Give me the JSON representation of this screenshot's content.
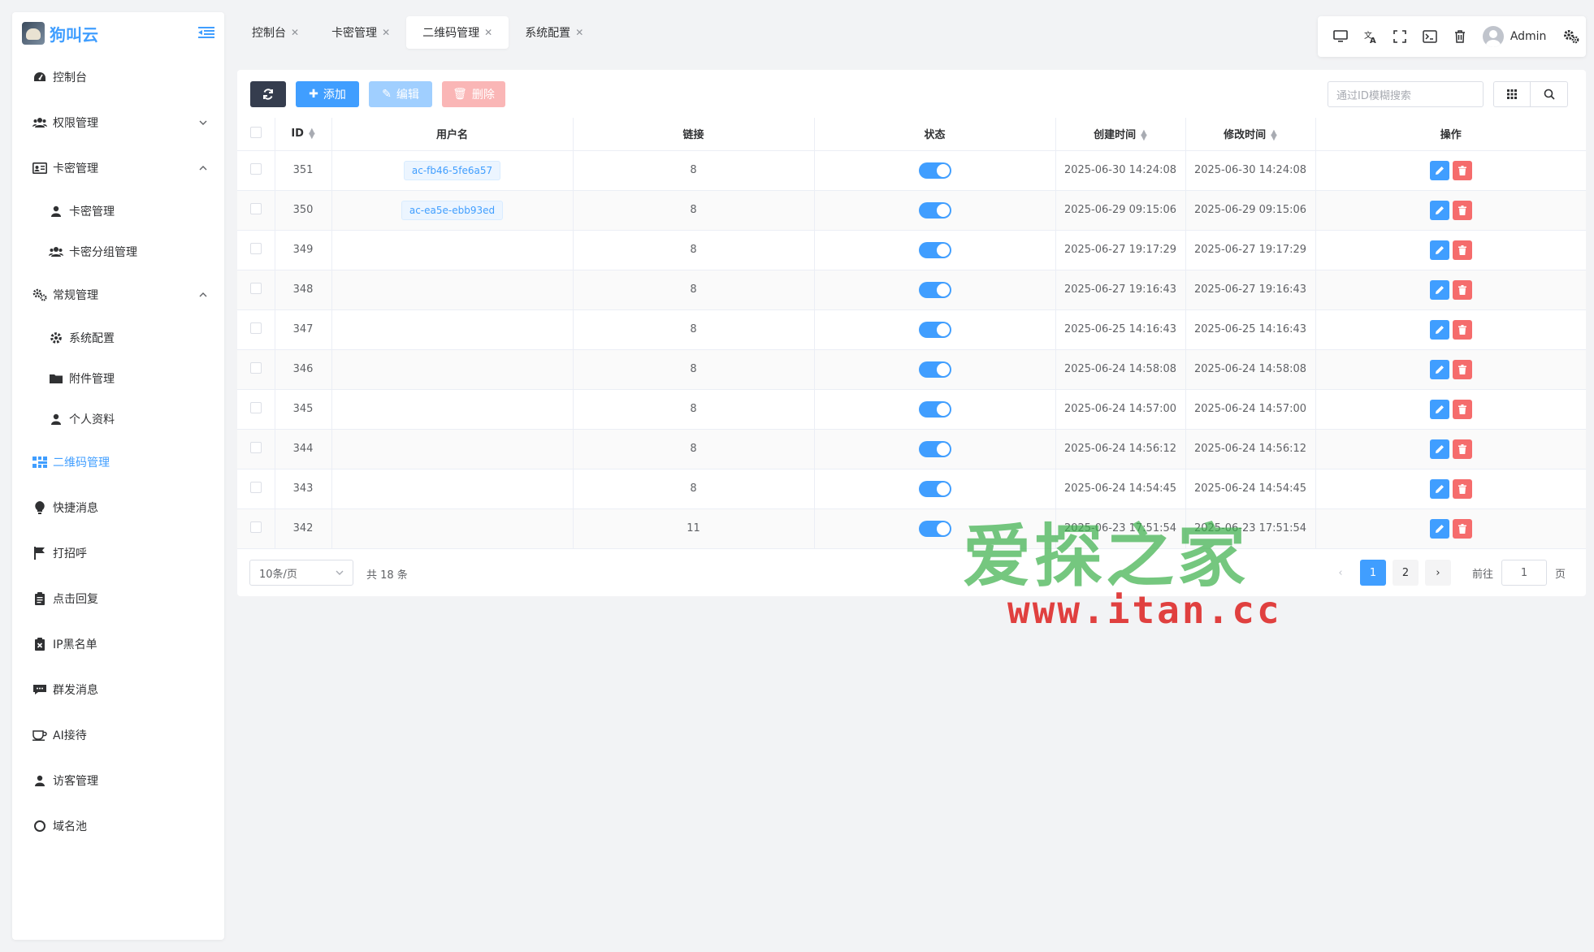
{
  "app": {
    "logo_text": "狗叫云"
  },
  "sidebar": {
    "items": [
      {
        "label": "控制台",
        "icon": "dashboard-icon",
        "type": "top"
      },
      {
        "label": "权限管理",
        "icon": "users-icon",
        "type": "top",
        "arrow": "down"
      },
      {
        "label": "卡密管理",
        "icon": "id-card-icon",
        "type": "top",
        "arrow": "up"
      },
      {
        "label": "卡密管理",
        "icon": "user-icon",
        "type": "sub"
      },
      {
        "label": "卡密分组管理",
        "icon": "users-icon",
        "type": "sub"
      },
      {
        "label": "常规管理",
        "icon": "cogs-icon",
        "type": "top",
        "arrow": "up"
      },
      {
        "label": "系统配置",
        "icon": "gear-icon",
        "type": "sub"
      },
      {
        "label": "附件管理",
        "icon": "folder-icon",
        "type": "sub"
      },
      {
        "label": "个人资料",
        "icon": "user-icon",
        "type": "sub"
      },
      {
        "label": "二维码管理",
        "icon": "qrcode-icon",
        "type": "top",
        "active": true
      },
      {
        "label": "快捷消息",
        "icon": "bulb-icon",
        "type": "top"
      },
      {
        "label": "打招呼",
        "icon": "flag-icon",
        "type": "top"
      },
      {
        "label": "点击回复",
        "icon": "clipboard-icon",
        "type": "top"
      },
      {
        "label": "IP黑名单",
        "icon": "ban-icon",
        "type": "top"
      },
      {
        "label": "群发消息",
        "icon": "comment-icon",
        "type": "top"
      },
      {
        "label": "AI接待",
        "icon": "coffee-icon",
        "type": "top"
      },
      {
        "label": "访客管理",
        "icon": "user-icon",
        "type": "top"
      },
      {
        "label": "域名池",
        "icon": "circle-icon",
        "type": "top"
      }
    ]
  },
  "tabs": [
    {
      "label": "控制台",
      "active": false
    },
    {
      "label": "卡密管理",
      "active": false
    },
    {
      "label": "二维码管理",
      "active": true
    },
    {
      "label": "系统配置",
      "active": false
    }
  ],
  "toolbar": {
    "user": "Admin"
  },
  "actions": {
    "add": "添加",
    "edit": "编辑",
    "delete": "删除"
  },
  "search": {
    "placeholder": "通过ID模糊搜索"
  },
  "table": {
    "columns": [
      "ID",
      "用户名",
      "链接",
      "状态",
      "创建时间",
      "修改时间",
      "操作"
    ],
    "rows": [
      {
        "id": "351",
        "username": "ac-fb46-5fe6a57",
        "link": "8",
        "status": true,
        "created": "2025-06-30 14:24:08",
        "updated": "2025-06-30 14:24:08"
      },
      {
        "id": "350",
        "username": "ac-ea5e-ebb93ed",
        "link": "8",
        "status": true,
        "created": "2025-06-29 09:15:06",
        "updated": "2025-06-29 09:15:06"
      },
      {
        "id": "349",
        "username": "",
        "link": "8",
        "status": true,
        "created": "2025-06-27 19:17:29",
        "updated": "2025-06-27 19:17:29"
      },
      {
        "id": "348",
        "username": "",
        "link": "8",
        "status": true,
        "created": "2025-06-27 19:16:43",
        "updated": "2025-06-27 19:16:43"
      },
      {
        "id": "347",
        "username": "",
        "link": "8",
        "status": true,
        "created": "2025-06-25 14:16:43",
        "updated": "2025-06-25 14:16:43"
      },
      {
        "id": "346",
        "username": "",
        "link": "8",
        "status": true,
        "created": "2025-06-24 14:58:08",
        "updated": "2025-06-24 14:58:08"
      },
      {
        "id": "345",
        "username": "",
        "link": "8",
        "status": true,
        "created": "2025-06-24 14:57:00",
        "updated": "2025-06-24 14:57:00"
      },
      {
        "id": "344",
        "username": "",
        "link": "8",
        "status": true,
        "created": "2025-06-24 14:56:12",
        "updated": "2025-06-24 14:56:12"
      },
      {
        "id": "343",
        "username": "",
        "link": "8",
        "status": true,
        "created": "2025-06-24 14:54:45",
        "updated": "2025-06-24 14:54:45"
      },
      {
        "id": "342",
        "username": "",
        "link": "11",
        "status": true,
        "created": "2025-06-23 17:51:54",
        "updated": "2025-06-23 17:51:54"
      }
    ]
  },
  "pagination": {
    "page_size": "10条/页",
    "total": "共 18 条",
    "pages": [
      "1",
      "2"
    ],
    "current": "1",
    "goto_prefix": "前往",
    "goto_value": "1",
    "goto_suffix": "页"
  },
  "watermark": {
    "line1": "爱探之家",
    "line2": "www.itan.cc"
  }
}
